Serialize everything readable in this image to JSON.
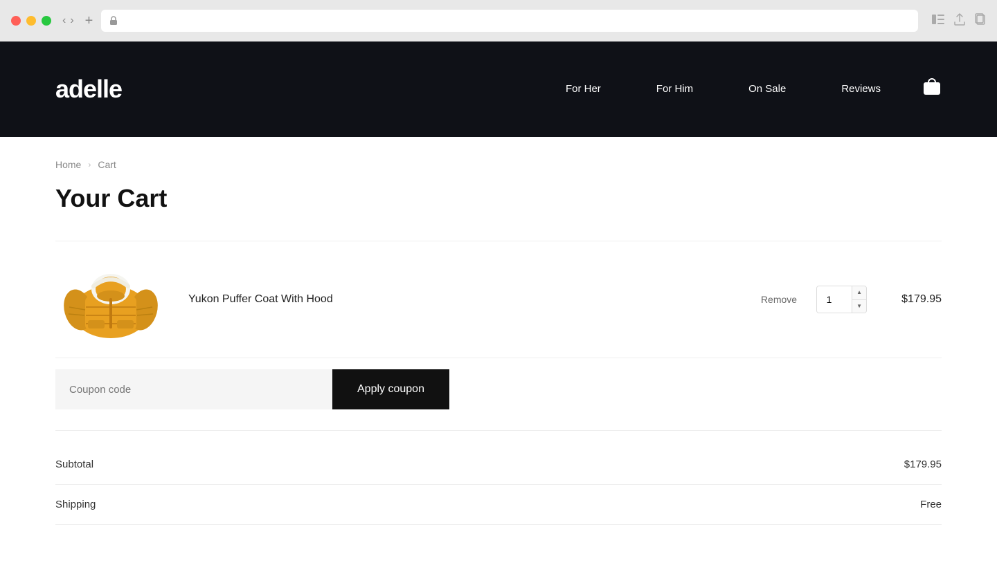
{
  "browser": {
    "address": ""
  },
  "header": {
    "logo": "adelle",
    "nav": [
      {
        "label": "For Her",
        "id": "for-her"
      },
      {
        "label": "For Him",
        "id": "for-him"
      },
      {
        "label": "On Sale",
        "id": "on-sale"
      },
      {
        "label": "Reviews",
        "id": "reviews"
      }
    ]
  },
  "breadcrumb": {
    "home": "Home",
    "separator": "›",
    "current": "Cart"
  },
  "page": {
    "title": "Your Cart"
  },
  "cart": {
    "item": {
      "name": "Yukon Puffer Coat With Hood",
      "quantity": "1",
      "price": "$179.95",
      "remove_label": "Remove"
    },
    "coupon": {
      "placeholder": "Coupon code",
      "button_label": "Apply coupon"
    },
    "subtotal_label": "Subtotal",
    "subtotal_value": "$179.95",
    "shipping_label": "Shipping",
    "shipping_value": "Free"
  }
}
